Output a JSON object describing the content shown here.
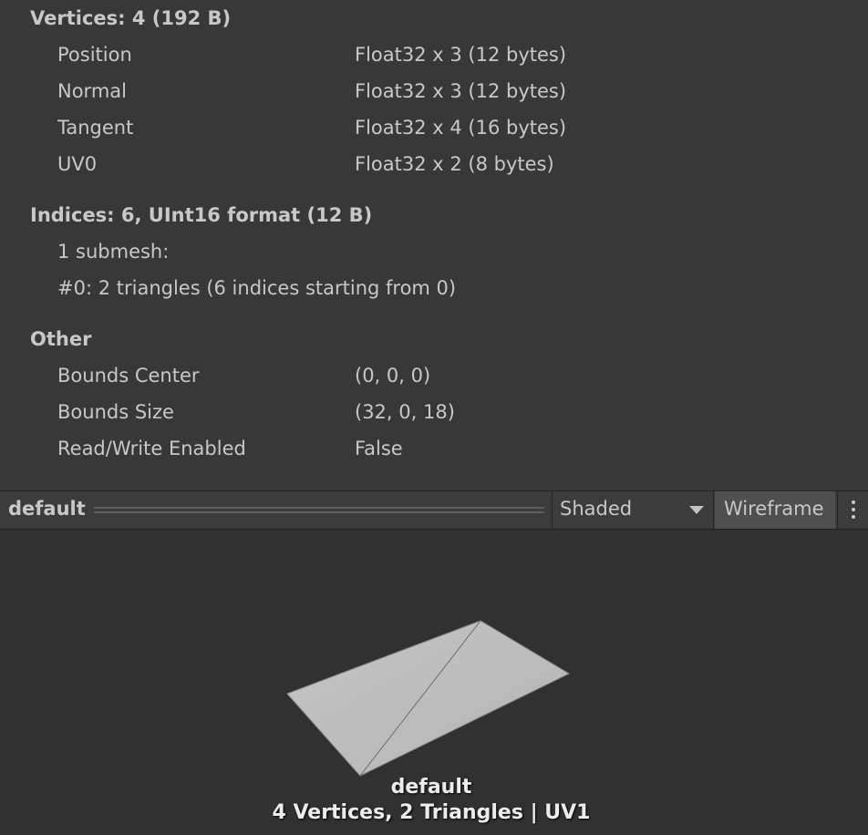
{
  "vertices": {
    "header": "Vertices: 4 (192 B)",
    "rows": [
      {
        "label": "Position",
        "value": "Float32 x 3 (12 bytes)"
      },
      {
        "label": "Normal",
        "value": "Float32 x 3 (12 bytes)"
      },
      {
        "label": "Tangent",
        "value": "Float32 x 4 (16 bytes)"
      },
      {
        "label": "UV0",
        "value": "Float32 x 2 (8 bytes)"
      }
    ]
  },
  "indices": {
    "header": "Indices: 6, UInt16 format (12 B)",
    "lines": [
      "1 submesh:",
      "#0: 2 triangles (6 indices starting from 0)"
    ]
  },
  "other": {
    "header": "Other",
    "rows": [
      {
        "label": "Bounds Center",
        "value": "(0, 0, 0)"
      },
      {
        "label": "Bounds Size",
        "value": "(32, 0, 18)"
      },
      {
        "label": "Read/Write Enabled",
        "value": "False"
      }
    ]
  },
  "toolbar": {
    "title": "default",
    "shading_selected": "Shaded",
    "wireframe_label": "Wireframe",
    "dropdown_icon": "chevron-down-icon",
    "menu_icon": "kebab-menu-icon"
  },
  "preview": {
    "mesh_name": "default",
    "stats": "4 Vertices, 2 Triangles | UV1"
  },
  "colors": {
    "background": "#383838",
    "preview_background": "#313131",
    "mesh_fill": "#bdbdbd",
    "mesh_edge": "#6b6b6b",
    "wireframe_button": "#4f4f4f"
  }
}
